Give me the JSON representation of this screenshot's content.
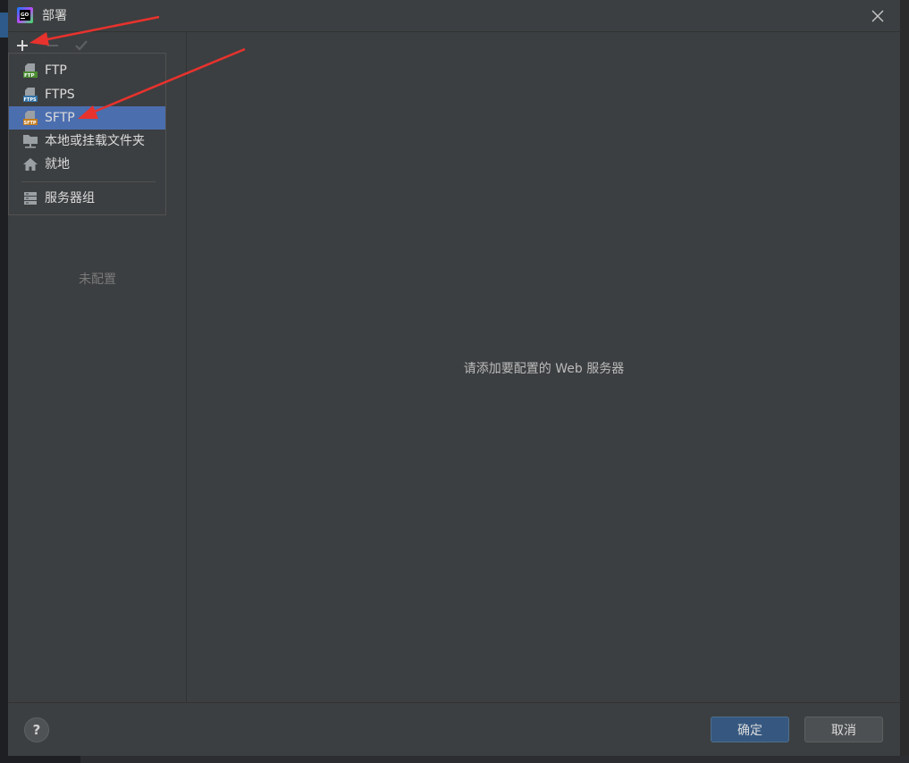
{
  "window": {
    "title": "部署",
    "close_icon": "close-icon"
  },
  "toolbar": {
    "add_icon": "plus-icon",
    "remove_icon": "minus-icon",
    "apply_icon": "check-icon"
  },
  "left_panel": {
    "empty_text": "未配置"
  },
  "main": {
    "hint": "请添加要配置的 Web 服务器"
  },
  "menu": {
    "items": [
      {
        "label": "FTP",
        "icon": "ftp-icon",
        "selected": false
      },
      {
        "label": "FTPS",
        "icon": "ftps-icon",
        "selected": false
      },
      {
        "label": "SFTP",
        "icon": "sftp-icon",
        "selected": true
      },
      {
        "label": "本地或挂载文件夹",
        "icon": "folder-icon",
        "selected": false
      },
      {
        "label": "就地",
        "icon": "home-icon",
        "selected": false
      },
      {
        "label": "服务器组",
        "icon": "server-group-icon",
        "selected": false
      }
    ]
  },
  "footer": {
    "help_label": "?",
    "ok_label": "确定",
    "cancel_label": "取消"
  },
  "colors": {
    "dialog_bg": "#3c3f41",
    "selection": "#4b6eaf",
    "primary_button": "#365880",
    "annotation_arrow": "#e8322d"
  }
}
